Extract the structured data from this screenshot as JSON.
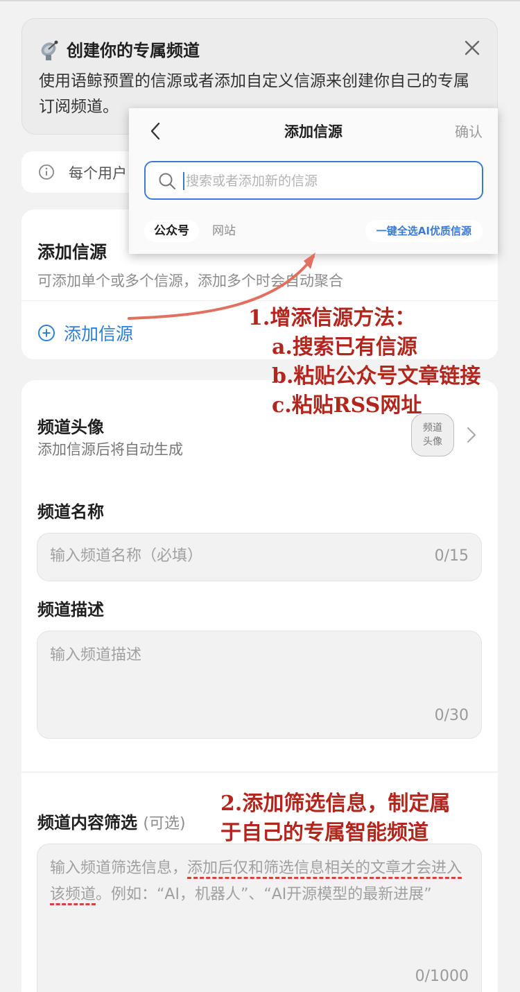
{
  "banner": {
    "title": "创建你的专属频道",
    "description": "使用语鲸预置的信源或者添加自定义信源来创建你自己的专属订阅频道。"
  },
  "notice": {
    "text": "每个用户"
  },
  "source_card": {
    "heading": "添加信源",
    "subtext": "可添加单个或多个信源，添加多个时会自动聚合",
    "add_label": "添加信源"
  },
  "form": {
    "avatar": {
      "label": "频道头像",
      "sublabel": "添加信源后将自动生成",
      "placeholder_line1": "频道",
      "placeholder_line2": "头像"
    },
    "name": {
      "label": "频道名称",
      "placeholder": "输入频道名称（必填）",
      "count": "0/15"
    },
    "description": {
      "label": "频道描述",
      "placeholder": "输入频道描述",
      "count": "0/30"
    },
    "filter": {
      "label": "频道内容筛选",
      "optional": "(可选)",
      "placeholder_part1": "输入频道筛选信息，",
      "placeholder_part2": "添加后仅和筛选信息相关的文章才会进入该频道",
      "placeholder_part3": "。例如：“AI，机器人”、“AI开源模型的最新进展”",
      "count": "0/1000"
    }
  },
  "popup": {
    "title": "添加信源",
    "confirm": "确认",
    "search_placeholder": "搜索或者添加新的信源",
    "tabs": [
      "公众号",
      "网站"
    ],
    "ai_button": "一键全选AI优质信源"
  },
  "annotations": {
    "note1": {
      "line1": "1.增添信源方法：",
      "line2": "a.搜索已有信源",
      "line3": "b.粘贴公众号文章链接",
      "line4": "c.粘贴RSS网址"
    },
    "note2": {
      "line1": "2.添加筛选信息，制定属",
      "line2": "于自己的专属智能频道"
    }
  },
  "colors": {
    "accent": "#2f7fd3",
    "annotation": "#b3261e",
    "arrow": "#e07060"
  }
}
